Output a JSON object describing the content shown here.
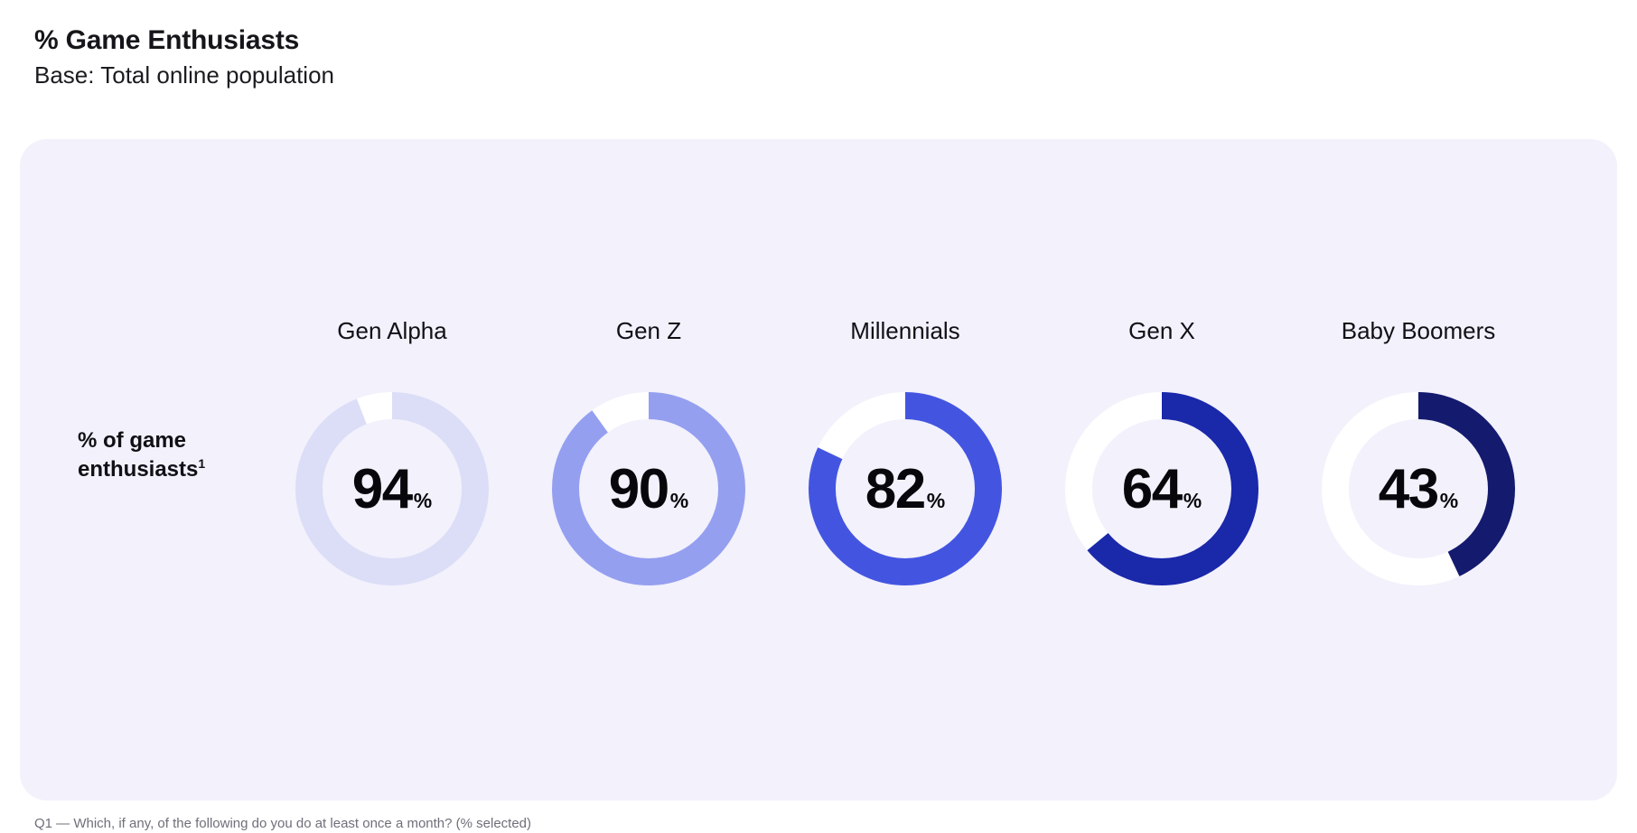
{
  "header": {
    "title": "% Game Enthusiasts",
    "subtitle": "Base: Total online population"
  },
  "row_label": {
    "text": "% of game enthusiasts",
    "footnote_marker": "1"
  },
  "footnote": {
    "text": "Q1 — Which, if any, of the following do you do at least once a month? (% selected)"
  },
  "colors": {
    "card_background": "#f2f1fc",
    "track": "#ffffff",
    "page_background": "#ffffff",
    "text": "#101015"
  },
  "chart_data": {
    "type": "pie",
    "title": "% Game Enthusiasts",
    "subtitle": "Base: Total online population",
    "series_label": "% of game enthusiasts",
    "categories": [
      "Gen Alpha",
      "Gen Z",
      "Millennials",
      "Gen X",
      "Baby Boomers"
    ],
    "values": [
      94,
      90,
      82,
      64,
      43
    ],
    "unit": "%",
    "ylim": [
      0,
      100
    ],
    "legend": "none",
    "grid": false,
    "donuts": [
      {
        "label": "Gen Alpha",
        "value": 94,
        "value_text": "94",
        "unit": "%",
        "color": "#dcdef7"
      },
      {
        "label": "Gen Z",
        "value": 90,
        "value_text": "90",
        "unit": "%",
        "color": "#959ff0"
      },
      {
        "label": "Millennials",
        "value": 82,
        "value_text": "82",
        "unit": "%",
        "color": "#4355e0"
      },
      {
        "label": "Gen X",
        "value": 64,
        "value_text": "64",
        "unit": "%",
        "color": "#1a28aa"
      },
      {
        "label": "Baby Boomers",
        "value": 43,
        "value_text": "43",
        "unit": "%",
        "color": "#141a6e"
      }
    ]
  }
}
